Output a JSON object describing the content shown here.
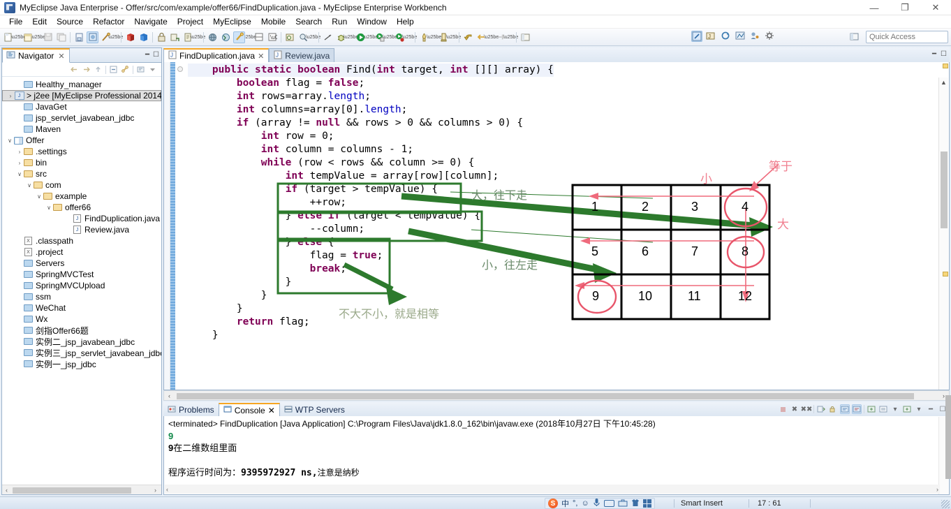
{
  "window": {
    "title": "MyEclipse Java Enterprise - Offer/src/com/example/offer66/FindDuplication.java - MyEclipse Enterprise Workbench",
    "app_icon": "myeclipse-icon",
    "minimize": "—",
    "maximize": "❐",
    "close": "✕"
  },
  "menu": {
    "items": [
      "File",
      "Edit",
      "Source",
      "Refactor",
      "Navigate",
      "Project",
      "MyEclipse",
      "Mobile",
      "Search",
      "Run",
      "Window",
      "Help"
    ]
  },
  "toolbar": {
    "quick_access_placeholder": "Quick Access",
    "quick_access_value": ""
  },
  "navigator": {
    "tab_label": "Navigator",
    "tab_close": "✕",
    "tree": [
      {
        "label": "Healthy_manager",
        "indent": 1,
        "icon": "folder-icon",
        "expander": "",
        "selected": false
      },
      {
        "label": "> j2ee  [MyEclipse Professional 2014",
        "indent": 0,
        "icon": "java-project-icon",
        "expander": "›",
        "selected": true
      },
      {
        "label": "JavaGet",
        "indent": 1,
        "icon": "folder-icon",
        "expander": "",
        "selected": false
      },
      {
        "label": "jsp_servlet_javabean_jdbc",
        "indent": 1,
        "icon": "folder-icon",
        "expander": "",
        "selected": false
      },
      {
        "label": "Maven",
        "indent": 1,
        "icon": "folder-icon",
        "expander": "",
        "selected": false
      },
      {
        "label": "Offer",
        "indent": 0,
        "icon": "project-icon",
        "expander": "∨",
        "selected": false
      },
      {
        "label": ".settings",
        "indent": 1,
        "icon": "folder-open-icon",
        "expander": "›",
        "selected": false
      },
      {
        "label": "bin",
        "indent": 1,
        "icon": "folder-open-icon",
        "expander": "›",
        "selected": false
      },
      {
        "label": "src",
        "indent": 1,
        "icon": "folder-open-icon",
        "expander": "∨",
        "selected": false
      },
      {
        "label": "com",
        "indent": 2,
        "icon": "folder-open-icon",
        "expander": "∨",
        "selected": false
      },
      {
        "label": "example",
        "indent": 3,
        "icon": "folder-open-icon",
        "expander": "∨",
        "selected": false
      },
      {
        "label": "offer66",
        "indent": 4,
        "icon": "folder-open-icon",
        "expander": "∨",
        "selected": false
      },
      {
        "label": "FindDuplication.java",
        "indent": 6,
        "icon": "java-file-icon",
        "expander": "",
        "selected": false
      },
      {
        "label": "Review.java",
        "indent": 6,
        "icon": "java-file-icon",
        "expander": "",
        "selected": false
      },
      {
        "label": ".classpath",
        "indent": 1,
        "icon": "xml-file-icon",
        "expander": "",
        "selected": false
      },
      {
        "label": ".project",
        "indent": 1,
        "icon": "xml-file-icon",
        "expander": "",
        "selected": false
      },
      {
        "label": "Servers",
        "indent": 1,
        "icon": "folder-icon",
        "expander": "",
        "selected": false
      },
      {
        "label": "SpringMVCTest",
        "indent": 1,
        "icon": "folder-icon",
        "expander": "",
        "selected": false
      },
      {
        "label": "SpringMVCUpload",
        "indent": 1,
        "icon": "folder-icon",
        "expander": "",
        "selected": false
      },
      {
        "label": "ssm",
        "indent": 1,
        "icon": "folder-icon",
        "expander": "",
        "selected": false
      },
      {
        "label": "WeChat",
        "indent": 1,
        "icon": "folder-icon",
        "expander": "",
        "selected": false
      },
      {
        "label": "Wx",
        "indent": 1,
        "icon": "folder-icon",
        "expander": "",
        "selected": false
      },
      {
        "label": "剑指Offer66题",
        "indent": 1,
        "icon": "folder-icon",
        "expander": "",
        "selected": false
      },
      {
        "label": "实例二_jsp_javabean_jdbc",
        "indent": 1,
        "icon": "folder-icon",
        "expander": "",
        "selected": false
      },
      {
        "label": "实例三_jsp_servlet_javabean_jdbc",
        "indent": 1,
        "icon": "folder-icon",
        "expander": "",
        "selected": false
      },
      {
        "label": "实例一_jsp_jdbc",
        "indent": 1,
        "icon": "folder-icon",
        "expander": "",
        "selected": false
      }
    ]
  },
  "editor": {
    "tabs": [
      {
        "label": "FindDuplication.java",
        "active": true,
        "close": "✕"
      },
      {
        "label": "Review.java",
        "active": false,
        "close": ""
      }
    ],
    "code_lines": [
      "    <k>public</k> <k>static</k> <k>boolean</k> Find(<k>int</k> target, <k>int</k> [][] array) {",
      "        <k>boolean</k> flag = <k>false</k>;",
      "        <k>int</k> rows=array.<f>length</f>;",
      "        <k>int</k> columns=array[0].<f>length</f>;",
      "        <k>if</k> (array != <k>null</k> && rows > 0 && columns > 0) {",
      "            <k>int</k> row = 0;",
      "            <k>int</k> column = columns - 1;",
      "            <k>while</k> (row < rows && column >= 0) {",
      "                <k>int</k> tempValue = array[row][column];",
      "                <k>if</k> (target > tempValue) {",
      "                    ++row;",
      "                } <k>else</k> <k>if</k> (target < tempValue) {",
      "                    --column;",
      "                } <k>else</k> {",
      "                    flag = <k>true</k>;",
      "                    <k>break</k>;",
      "                }",
      "            }",
      "        }",
      "        <k>return</k> flag;",
      "    }"
    ]
  },
  "annotations": {
    "green_box_labels": [
      "大，往下走",
      "小，往左走",
      "不大不小，就是相等"
    ],
    "red_labels": [
      "小",
      "等于",
      "大"
    ],
    "green_color": "#2d7a2d",
    "red_color": "#e8556a"
  },
  "matrix": {
    "rows": [
      [
        "1",
        "2",
        "3",
        "4"
      ],
      [
        "5",
        "6",
        "7",
        "8"
      ],
      [
        "9",
        "10",
        "11",
        "12"
      ]
    ],
    "circled": [
      "4",
      "8",
      "9"
    ]
  },
  "console": {
    "tabs": [
      {
        "label": "Problems",
        "active": false,
        "icon": "problems-icon",
        "close": ""
      },
      {
        "label": "Console",
        "active": true,
        "icon": "console-icon",
        "close": "✕"
      },
      {
        "label": "WTP Servers",
        "active": false,
        "icon": "servers-icon",
        "close": ""
      }
    ],
    "header_line": "<terminated> FindDuplication [Java Application] C:\\Program Files\\Java\\jdk1.8.0_162\\bin\\javaw.exe (2018年10月27日 下午10:45:28)",
    "out_line1": "9",
    "out_line2_num": "9",
    "out_line2_text": "在二维数组里面",
    "out_line3_prefix": "程序运行时间为：",
    "out_line3_num": "9395972927  ns,",
    "out_line3_suffix": "注意是纳秒"
  },
  "statusbar": {
    "ime_sogou": "S",
    "ime_mode": "中",
    "ime_punct": "°,",
    "ime_emoji": "☺",
    "ime_mic": "🎙",
    "ime_keyboard": "keyboard-icon",
    "ime_toolbox": "toolbox-icon",
    "ime_skin": "skin-icon",
    "ime_apps": "apps-icon",
    "insert_mode": "Smart Insert",
    "cursor_position": "17 : 61"
  }
}
